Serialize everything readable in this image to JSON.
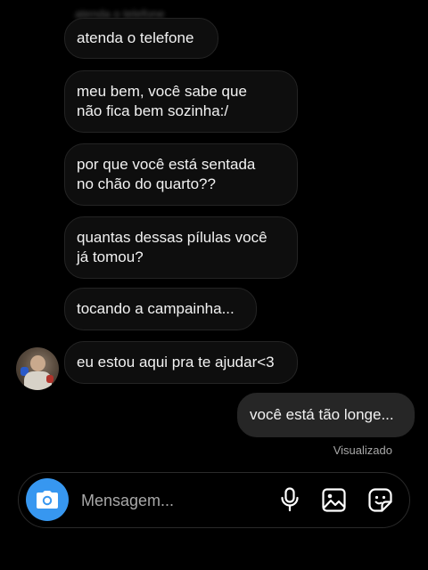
{
  "chat": {
    "ghost_message": "atenda o telefone",
    "received": [
      {
        "text": "atenda o telefone"
      },
      {
        "line1": "meu bem, você sabe que",
        "line2": "não fica bem sozinha:/"
      },
      {
        "line1": "por que você está sentada",
        "line2": "no chão do quarto??"
      },
      {
        "line1": "quantas dessas pílulas você",
        "line2": "já tomou?"
      },
      {
        "text": "tocando a campainha..."
      },
      {
        "text": "eu estou aqui pra te ajudar<3"
      }
    ],
    "sent": [
      {
        "text": "você está tão longe..."
      }
    ],
    "seen_status": "Visualizado"
  },
  "composer": {
    "placeholder": "Mensagem..."
  },
  "colors": {
    "background": "#000000",
    "received_bubble": "#0e0e0e",
    "sent_bubble": "#262626",
    "camera_button": "#3797f0",
    "muted_text": "#a8a8a8"
  },
  "icons": [
    "camera-icon",
    "microphone-icon",
    "gallery-icon",
    "sticker-icon"
  ]
}
